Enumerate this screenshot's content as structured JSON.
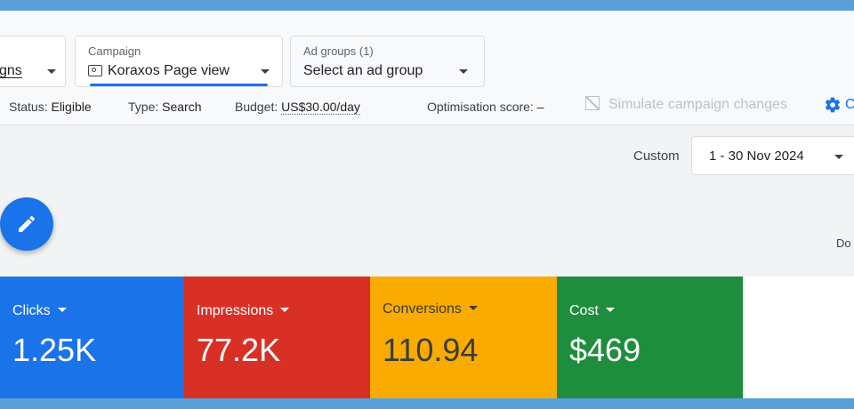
{
  "filters": {
    "campaigns_value": "gns",
    "campaign_label": "Campaign",
    "campaign_value": "Koraxos Page view",
    "adgroups_label": "Ad groups (1)",
    "adgroups_value": "Select an ad group"
  },
  "status": {
    "status_label": "Status:",
    "status_value": "Eligible",
    "type_label": "Type:",
    "type_value": "Search",
    "budget_label": "Budget:",
    "budget_value": "US$30.00/day",
    "optim_label": "Optimisation score:",
    "optim_value": "–"
  },
  "actions": {
    "simulate_label": "Simulate campaign changes",
    "gear_text": "C"
  },
  "date": {
    "custom_label": "Custom",
    "range": "1 - 30 Nov 2024"
  },
  "download_text": "Do",
  "metrics": [
    {
      "label": "Clicks",
      "value": "1.25K",
      "color": "#1a73e8"
    },
    {
      "label": "Impressions",
      "value": "77.2K",
      "color": "#d93025"
    },
    {
      "label": "Conversions",
      "value": "110.94",
      "color": "#f9ab00"
    },
    {
      "label": "Cost",
      "value": "$469",
      "color": "#1e8e3e"
    }
  ],
  "icons": {
    "edit": "pencil-icon",
    "simulate": "image-off-icon",
    "settings": "gear-icon",
    "campaign": "campaign-icon"
  },
  "colors": {
    "accent": "#1a73e8",
    "background": "#f1f3f4"
  }
}
